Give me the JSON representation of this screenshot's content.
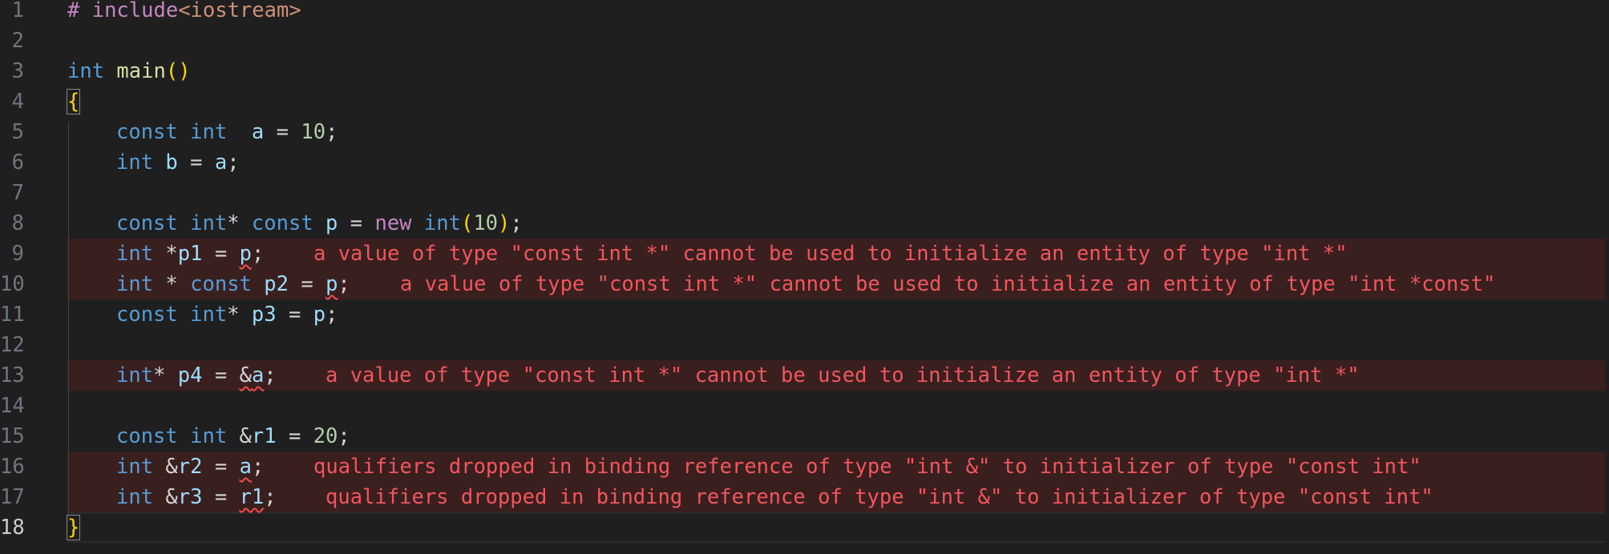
{
  "editor": {
    "language": "cpp",
    "active_line": "18",
    "lines": [
      {
        "n": "1"
      },
      {
        "n": "2"
      },
      {
        "n": "3"
      },
      {
        "n": "4"
      },
      {
        "n": "5"
      },
      {
        "n": "6"
      },
      {
        "n": "7"
      },
      {
        "n": "8"
      },
      {
        "n": "9"
      },
      {
        "n": "10"
      },
      {
        "n": "11"
      },
      {
        "n": "12"
      },
      {
        "n": "13"
      },
      {
        "n": "14"
      },
      {
        "n": "15"
      },
      {
        "n": "16"
      },
      {
        "n": "17"
      },
      {
        "n": "18"
      }
    ]
  },
  "tokens": {
    "hash": "#",
    "include_kw": "include",
    "header": "<iostream>",
    "int_kw": "int",
    "const_kw": "const",
    "new_kw": "new",
    "main": "main",
    "open_paren": "(",
    "close_paren": ")",
    "open_brace": "{",
    "close_brace": "}",
    "a": "a",
    "b": "b",
    "p": "p",
    "p1": "p1",
    "p2": "p2",
    "p3": "p3",
    "p4": "p4",
    "r1": "r1",
    "r2": "r2",
    "r3": "r3",
    "ten": "10",
    "twenty": "20"
  },
  "diagnostics": {
    "line9": "a value of type \"const int *\" cannot be used to initialize an entity of type \"int *\"",
    "line10": "a value of type \"const int *\" cannot be used to initialize an entity of type \"int *const\"",
    "line13": "a value of type \"const int *\" cannot be used to initialize an entity of type \"int *\"",
    "line16": "qualifiers dropped in binding reference of type \"int &\" to initializer of type \"const int\"",
    "line17": "qualifiers dropped in binding reference of type \"int &\" to initializer of type \"const int\""
  },
  "colors": {
    "background": "#1f1f1f",
    "keyword": "#569cd6",
    "function": "#dcdcaa",
    "variable": "#9cdcfe",
    "number": "#b5cea8",
    "preprocessor": "#c586c0",
    "string": "#ce9178",
    "error_text": "#f1565c",
    "error_line_bg": "#3a1f1f",
    "line_number": "#6e7681"
  }
}
